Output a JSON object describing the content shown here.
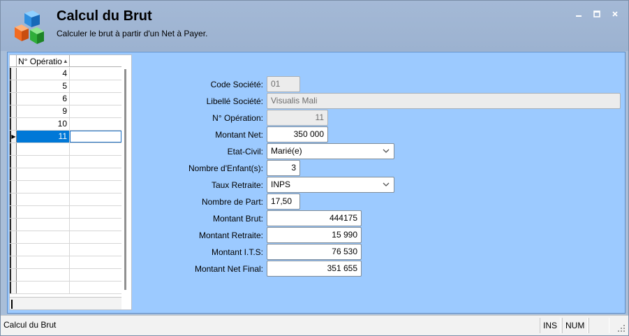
{
  "header": {
    "title": "Calcul du Brut",
    "subtitle": "Calculer le brut à partir d'un Net à Payer.",
    "app_icon": "colored-cubes-icon"
  },
  "window_controls": {
    "minimize": "–",
    "maximize": "□",
    "close": "×"
  },
  "grid": {
    "column_header": "N° Opératio",
    "rows": [
      "4",
      "5",
      "6",
      "9",
      "10",
      "11"
    ],
    "selected_row": "11"
  },
  "form": {
    "code_societe": {
      "label": "Code Société:",
      "value": "01"
    },
    "libelle_societe": {
      "label": "Libellé Société:",
      "value": "Visualis Mali"
    },
    "num_operation": {
      "label": "N° Opération:",
      "value": "11"
    },
    "montant_net": {
      "label": "Montant Net:",
      "value": "350 000"
    },
    "etat_civil": {
      "label": "Etat-Civil:",
      "value": "Marié(e)"
    },
    "nombre_enfants": {
      "label": "Nombre d'Enfant(s):",
      "value": "3"
    },
    "taux_retraite": {
      "label": "Taux Retraite:",
      "value": "INPS"
    },
    "nombre_part": {
      "label": "Nombre de Part:",
      "value": "17,50"
    },
    "montant_brut": {
      "label": "Montant Brut:",
      "value": "444175"
    },
    "montant_retraite": {
      "label": "Montant Retraite:",
      "value": "15 990"
    },
    "montant_its": {
      "label": "Montant I.T.S:",
      "value": "76 530"
    },
    "montant_net_final": {
      "label": "Montant Net Final:",
      "value": "351 655"
    }
  },
  "statusbar": {
    "text": "Calcul du Brut",
    "ins": "INS",
    "num": "NUM"
  }
}
